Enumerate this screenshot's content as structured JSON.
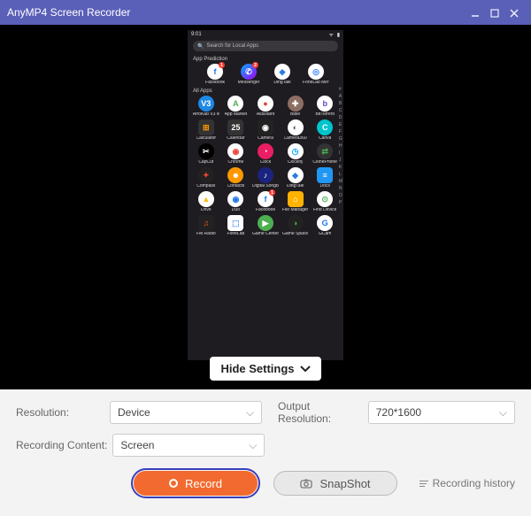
{
  "titlebar": {
    "title": "AnyMP4 Screen Recorder"
  },
  "phone": {
    "status": {
      "time": "9:01"
    },
    "search_placeholder": "Search for Local Apps",
    "section_prediction": "App Prediction",
    "section_all": "All Apps",
    "prediction_apps": [
      {
        "name": "Facebook",
        "letter": "f",
        "bg": "#fff",
        "fg": "#1877f2",
        "badge": "1"
      },
      {
        "name": "Messenger",
        "letter": "✆",
        "bg": "linear-gradient(135deg,#0af,#a0f)",
        "fg": "#fff",
        "badge": "2"
      },
      {
        "name": "DingTalk",
        "letter": "◆",
        "bg": "#fff",
        "fg": "#2a7de1"
      },
      {
        "name": "FoneLab Mirror",
        "letter": "◎",
        "bg": "#fff",
        "fg": "#3b82f6"
      }
    ],
    "all_apps": [
      {
        "name": "AfroKab V3 Mobile Pos",
        "letter": "V3",
        "bg": "#1e88e5",
        "fg": "#fff"
      },
      {
        "name": "App Market",
        "letter": "A",
        "bg": "#fff",
        "fg": "#4caf50"
      },
      {
        "name": "Assistant",
        "letter": "●",
        "bg": "#fff",
        "fg": "#ea4335"
      },
      {
        "name": "Bible",
        "letter": "✚",
        "bg": "#8d6e63",
        "fg": "#fff"
      },
      {
        "name": "BitTorrent",
        "letter": "b",
        "bg": "#fff",
        "fg": "#6b46c1"
      },
      {
        "name": "Calculator",
        "letter": "⊞",
        "bg": "#333",
        "fg": "#ff9800",
        "shape": "sq"
      },
      {
        "name": "Calendar",
        "letter": "25",
        "bg": "#333",
        "fg": "#fff",
        "shape": "sq"
      },
      {
        "name": "Camera",
        "letter": "◉",
        "bg": "#222",
        "fg": "#fff",
        "shape": "sq"
      },
      {
        "name": "Camera360",
        "letter": "◐",
        "bg": "#fff",
        "fg": "#555"
      },
      {
        "name": "Canva",
        "letter": "C",
        "bg": "#00c4cc",
        "fg": "#fff"
      },
      {
        "name": "CapCut",
        "letter": "✂",
        "bg": "#000",
        "fg": "#fff"
      },
      {
        "name": "Chrome",
        "letter": "◉",
        "bg": "#fff",
        "fg": "#ea4335"
      },
      {
        "name": "Clock",
        "letter": "◔",
        "bg": "#e91e63",
        "fg": "#fff"
      },
      {
        "name": "Clockify",
        "letter": "◷",
        "bg": "#fff",
        "fg": "#03a9f4"
      },
      {
        "name": "ClonePhone",
        "letter": "⇄",
        "bg": "#333",
        "fg": "#4caf50"
      },
      {
        "name": "Compass",
        "letter": "✦",
        "bg": "#222",
        "fg": "#f44336"
      },
      {
        "name": "Contacts",
        "letter": "☻",
        "bg": "#ff9800",
        "fg": "#fff"
      },
      {
        "name": "Digital Songbook",
        "letter": "♪",
        "bg": "#1a237e",
        "fg": "#fff"
      },
      {
        "name": "DingTalk",
        "letter": "◆",
        "bg": "#fff",
        "fg": "#2a7de1"
      },
      {
        "name": "Docs",
        "letter": "≡",
        "bg": "#2196f3",
        "fg": "#fff",
        "shape": "sq"
      },
      {
        "name": "Drive",
        "letter": "▲",
        "bg": "#fff",
        "fg": "#fbbc04"
      },
      {
        "name": "Duo",
        "letter": "◉",
        "bg": "#fff",
        "fg": "#1a73e8"
      },
      {
        "name": "Facebook",
        "letter": "f",
        "bg": "#fff",
        "fg": "#1877f2",
        "badge": "1"
      },
      {
        "name": "File Manager",
        "letter": "⌂",
        "bg": "#ffb300",
        "fg": "#fff",
        "shape": "sq"
      },
      {
        "name": "Find Device",
        "letter": "⊙",
        "bg": "#fff",
        "fg": "#4caf50"
      },
      {
        "name": "FM Radio",
        "letter": "♫",
        "bg": "#222",
        "fg": "#ff5722",
        "shape": "sq"
      },
      {
        "name": "FoneLab",
        "letter": "⬚",
        "bg": "#fff",
        "fg": "#3b82f6",
        "shape": "sq"
      },
      {
        "name": "Game Center",
        "letter": "▶",
        "bg": "#4caf50",
        "fg": "#fff"
      },
      {
        "name": "Game Space",
        "letter": "◑",
        "bg": "#222",
        "fg": "#4caf50"
      },
      {
        "name": "GCam",
        "letter": "G",
        "bg": "#fff",
        "fg": "#1a73e8"
      }
    ],
    "index": [
      "#",
      "A",
      "B",
      "C",
      "D",
      "E",
      "F",
      "G",
      "H",
      "I",
      "J",
      "K",
      "L",
      "M",
      "N",
      "O",
      "P"
    ]
  },
  "hide_settings_label": "Hide Settings",
  "settings": {
    "resolution_label": "Resolution:",
    "resolution_value": "Device",
    "output_label": "Output Resolution:",
    "output_value": "720*1600",
    "content_label": "Recording Content:",
    "content_value": "Screen"
  },
  "actions": {
    "record_label": "Record",
    "snapshot_label": "SnapShot",
    "history_label": "Recording history"
  }
}
